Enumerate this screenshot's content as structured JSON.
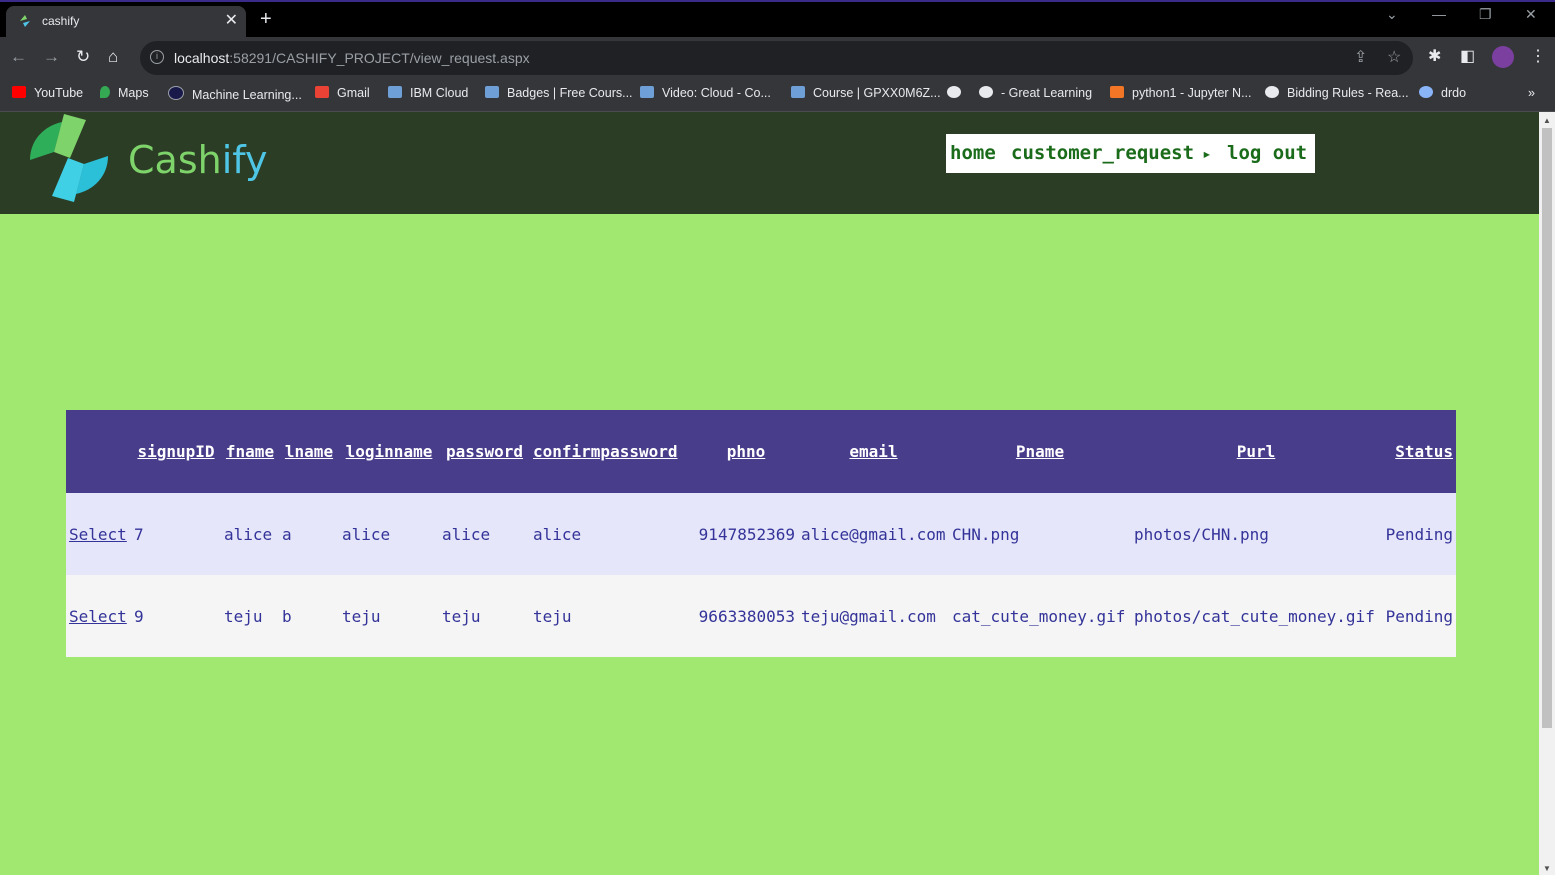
{
  "browser": {
    "tab_title": "cashify",
    "tab_close": "✕",
    "new_tab": "+",
    "url_host": "localhost",
    "url_rest": ":58291/CASHIFY_PROJECT/view_request.aspx",
    "bookmarks": [
      {
        "label": "YouTube",
        "color": "#ff0000"
      },
      {
        "label": "Maps",
        "color": "#34a853"
      },
      {
        "label": "Machine Learning...",
        "color": "#1a1a4a"
      },
      {
        "label": "Gmail",
        "color": "#ea4335"
      },
      {
        "label": "IBM Cloud",
        "color": "#6e9fd6"
      },
      {
        "label": "Badges | Free Cours...",
        "color": "#6e9fd6"
      },
      {
        "label": "Video: Cloud  - Co...",
        "color": "#6e9fd6"
      },
      {
        "label": "Course | GPXX0M6Z...",
        "color": "#6e9fd6"
      },
      {
        "label": "",
        "color": "#e8eaed"
      },
      {
        "label": "- Great Learning",
        "color": "#e8eaed"
      },
      {
        "label": "python1 - Jupyter N...",
        "color": "#f37626"
      },
      {
        "label": "Bidding Rules - Rea...",
        "color": "#e8eaed"
      },
      {
        "label": "drdo",
        "color": "#8ab4f8"
      }
    ],
    "more_bookmarks": "»"
  },
  "site": {
    "brand_part1": "Cash",
    "brand_part2": "ify",
    "nav_home": "home",
    "nav_customer_request": "customer_request",
    "nav_arrow": "▸",
    "nav_logout": "log out"
  },
  "grid": {
    "headers": [
      "signupID",
      "fname",
      "lname",
      "loginname",
      "password",
      "confirmpassword",
      "phno",
      "email",
      "Pname",
      "Purl",
      "Status"
    ],
    "select_label": "Select",
    "rows": [
      {
        "signupID": "7",
        "fname": "alice",
        "lname": "a",
        "loginname": "alice",
        "password": "alice",
        "confirmpassword": "alice",
        "phno": "9147852369",
        "email": "alice@gmail.com",
        "Pname": "CHN.png",
        "Purl": "photos/CHN.png",
        "Status": "Pending"
      },
      {
        "signupID": "9",
        "fname": "teju",
        "lname": "b",
        "loginname": "teju",
        "password": "teju",
        "confirmpassword": "teju",
        "phno": "9663380053",
        "email": "teju@gmail.com",
        "Pname": "cat_cute_money.gif",
        "Purl": "photos/cat_cute_money.gif",
        "Status": "Pending"
      }
    ]
  },
  "colors": {
    "page_bg": "#a0e870",
    "header_bg": "#2b3d24",
    "grid_header": "#483d8b",
    "row_odd": "#e6e6fa",
    "row_even": "#f5f5f5"
  }
}
